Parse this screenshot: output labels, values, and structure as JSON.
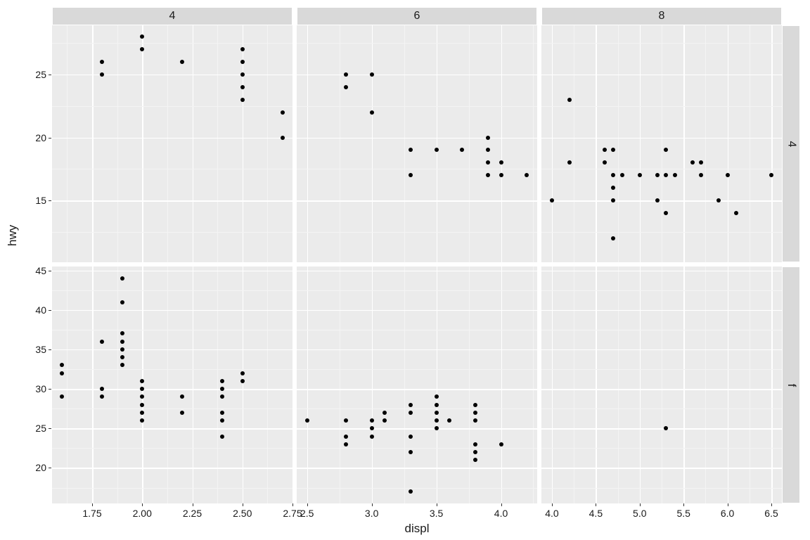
{
  "chart_data": {
    "type": "scatter",
    "xlabel": "displ",
    "ylabel": "hwy",
    "facet_cols": [
      "4",
      "6",
      "8"
    ],
    "facet_rows": [
      "4",
      "f"
    ],
    "x_ranges": {
      "4": [
        1.55,
        2.75
      ],
      "6": [
        2.42,
        4.28
      ],
      "8": [
        3.88,
        6.62
      ]
    },
    "y_ranges": {
      "4": [
        10.1,
        28.9
      ],
      "f": [
        15.5,
        45.5
      ]
    },
    "x_ticks": {
      "4": [
        1.75,
        2.0,
        2.25,
        2.5,
        2.75
      ],
      "6": [
        2.5,
        3.0,
        3.5,
        4.0
      ],
      "8": [
        4.0,
        4.5,
        5.0,
        5.5,
        6.0,
        6.5
      ]
    },
    "y_ticks": {
      "4": [
        15,
        20,
        25
      ],
      "f": [
        20,
        25,
        30,
        35,
        40,
        45
      ]
    },
    "x_tick_labels": {
      "4": [
        "1.75",
        "2.00",
        "2.25",
        "2.50",
        "2.75"
      ],
      "6": [
        "2.5",
        "3.0",
        "3.5",
        "4.0"
      ],
      "8": [
        "4.0",
        "4.5",
        "5.0",
        "5.5",
        "6.0",
        "6.5"
      ]
    },
    "series": {
      "4|4": [
        [
          1.8,
          26
        ],
        [
          1.8,
          25
        ],
        [
          2.0,
          28
        ],
        [
          2.0,
          27
        ],
        [
          2.2,
          26
        ],
        [
          2.5,
          27
        ],
        [
          2.5,
          26
        ],
        [
          2.5,
          25
        ],
        [
          2.5,
          24
        ],
        [
          2.5,
          23
        ],
        [
          2.7,
          22
        ],
        [
          2.7,
          20
        ]
      ],
      "6|4": [
        [
          2.8,
          25
        ],
        [
          2.8,
          24
        ],
        [
          3.0,
          25
        ],
        [
          3.0,
          22
        ],
        [
          3.3,
          17
        ],
        [
          3.3,
          19
        ],
        [
          3.5,
          19
        ],
        [
          3.7,
          19
        ],
        [
          3.9,
          17
        ],
        [
          3.9,
          18
        ],
        [
          3.9,
          19
        ],
        [
          3.9,
          20
        ],
        [
          4.0,
          17
        ],
        [
          4.0,
          18
        ],
        [
          4.2,
          17
        ]
      ],
      "8|4": [
        [
          4.0,
          15
        ],
        [
          4.2,
          18
        ],
        [
          4.2,
          23
        ],
        [
          4.6,
          18
        ],
        [
          4.6,
          19
        ],
        [
          4.7,
          17
        ],
        [
          4.7,
          19
        ],
        [
          4.7,
          16
        ],
        [
          4.7,
          15
        ],
        [
          4.7,
          12
        ],
        [
          4.8,
          17
        ],
        [
          5.0,
          17
        ],
        [
          5.2,
          17
        ],
        [
          5.2,
          15
        ],
        [
          5.3,
          19
        ],
        [
          5.3,
          17
        ],
        [
          5.3,
          14
        ],
        [
          5.4,
          17
        ],
        [
          5.6,
          18
        ],
        [
          5.7,
          17
        ],
        [
          5.7,
          18
        ],
        [
          5.9,
          15
        ],
        [
          6.0,
          17
        ],
        [
          6.1,
          14
        ],
        [
          6.5,
          17
        ]
      ],
      "4|f": [
        [
          1.6,
          33
        ],
        [
          1.6,
          32
        ],
        [
          1.6,
          29
        ],
        [
          1.8,
          36
        ],
        [
          1.8,
          29
        ],
        [
          1.8,
          30
        ],
        [
          1.9,
          44
        ],
        [
          1.9,
          41
        ],
        [
          1.9,
          33
        ],
        [
          1.9,
          34
        ],
        [
          1.9,
          35
        ],
        [
          1.9,
          36
        ],
        [
          1.9,
          37
        ],
        [
          2.0,
          31
        ],
        [
          2.0,
          30
        ],
        [
          2.0,
          29
        ],
        [
          2.0,
          28
        ],
        [
          2.0,
          27
        ],
        [
          2.0,
          26
        ],
        [
          2.2,
          29
        ],
        [
          2.2,
          27
        ],
        [
          2.4,
          31
        ],
        [
          2.4,
          30
        ],
        [
          2.4,
          29
        ],
        [
          2.4,
          27
        ],
        [
          2.4,
          26
        ],
        [
          2.4,
          24
        ],
        [
          2.5,
          32
        ],
        [
          2.5,
          31
        ]
      ],
      "6|f": [
        [
          2.5,
          26
        ],
        [
          2.8,
          26
        ],
        [
          2.8,
          24
        ],
        [
          2.8,
          23
        ],
        [
          3.0,
          26
        ],
        [
          3.0,
          25
        ],
        [
          3.0,
          24
        ],
        [
          3.1,
          27
        ],
        [
          3.1,
          26
        ],
        [
          3.3,
          28
        ],
        [
          3.3,
          27
        ],
        [
          3.3,
          24
        ],
        [
          3.3,
          22
        ],
        [
          3.3,
          17
        ],
        [
          3.5,
          29
        ],
        [
          3.5,
          28
        ],
        [
          3.5,
          27
        ],
        [
          3.5,
          26
        ],
        [
          3.5,
          25
        ],
        [
          3.6,
          26
        ],
        [
          3.8,
          28
        ],
        [
          3.8,
          26
        ],
        [
          3.8,
          27
        ],
        [
          3.8,
          23
        ],
        [
          3.8,
          22
        ],
        [
          3.8,
          21
        ],
        [
          4.0,
          23
        ]
      ],
      "8|f": [
        [
          5.3,
          25
        ]
      ]
    }
  }
}
